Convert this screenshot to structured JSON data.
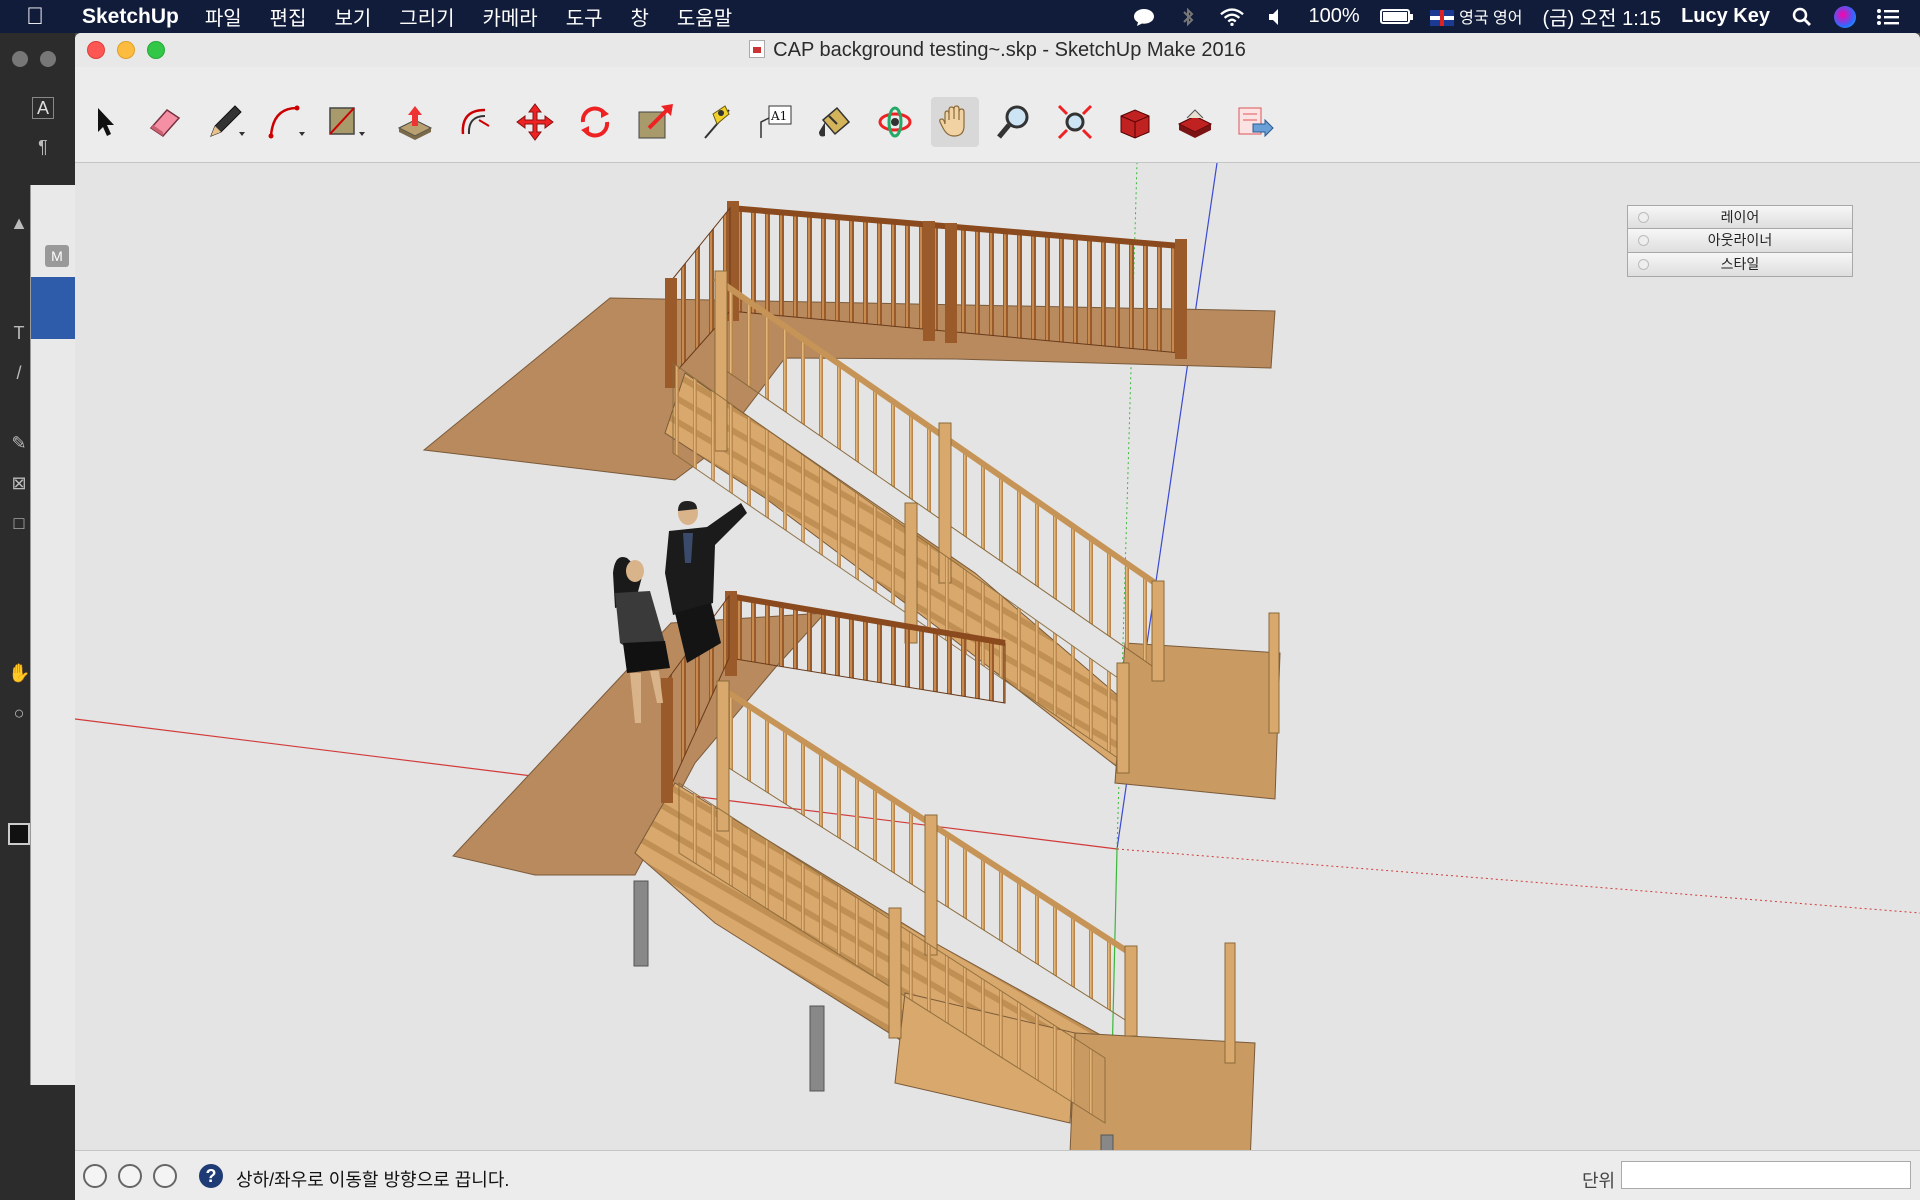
{
  "menubar": {
    "app_name": "SketchUp",
    "menus": [
      "파일",
      "편집",
      "보기",
      "그리기",
      "카메라",
      "도구",
      "창",
      "도움말"
    ],
    "battery": "100%",
    "battery_level": 1.0,
    "input_source": "영국 영어",
    "clock": "(금) 오전 1:15",
    "user": "Lucy Key"
  },
  "window": {
    "title": "CAP background testing~.skp - SketchUp Make 2016"
  },
  "toolbar": {
    "tools": [
      {
        "name": "select-tool",
        "icon": "arrow-icon"
      },
      {
        "name": "eraser-tool",
        "icon": "eraser-icon"
      },
      {
        "name": "line-tool",
        "icon": "pencil-icon"
      },
      {
        "name": "arc-tool",
        "icon": "arc-icon"
      },
      {
        "name": "rectangle-tool",
        "icon": "rectangle-icon"
      },
      {
        "name": "push-pull-tool",
        "icon": "push-pull-icon"
      },
      {
        "name": "offset-tool",
        "icon": "offset-icon"
      },
      {
        "name": "move-tool",
        "icon": "move-icon"
      },
      {
        "name": "rotate-tool",
        "icon": "rotate-icon"
      },
      {
        "name": "scale-tool",
        "icon": "scale-icon"
      },
      {
        "name": "tape-measure-tool",
        "icon": "tape-icon"
      },
      {
        "name": "text-tool",
        "icon": "text-icon",
        "label": "A1"
      },
      {
        "name": "paint-bucket-tool",
        "icon": "paint-bucket-icon"
      },
      {
        "name": "orbit-tool",
        "icon": "orbit-icon"
      },
      {
        "name": "pan-tool",
        "icon": "hand-icon"
      },
      {
        "name": "zoom-tool",
        "icon": "magnifier-icon"
      },
      {
        "name": "zoom-extents-tool",
        "icon": "zoom-extents-icon"
      },
      {
        "name": "3d-warehouse-tool",
        "icon": "warehouse-icon"
      },
      {
        "name": "extension-warehouse-tool",
        "icon": "extension-icon"
      },
      {
        "name": "send-to-layout-tool",
        "icon": "layout-icon"
      }
    ],
    "active_tool": "pan-tool"
  },
  "trays": [
    "레이어",
    "아웃라이너",
    "스타일"
  ],
  "statusbar": {
    "message": "상하/좌우로 이동할 방향으로 끕니다.",
    "measurements_label": "단위",
    "measurements_value": ""
  },
  "colors": {
    "menubar_bg": "#111c3a",
    "floor": "#b88a5e",
    "wood_light": "#d9a86c",
    "wood_dark": "#9a5a2a",
    "axis_red": "#d23a3a",
    "axis_blue": "#3a4ad2",
    "axis_green": "#3ab83a"
  }
}
